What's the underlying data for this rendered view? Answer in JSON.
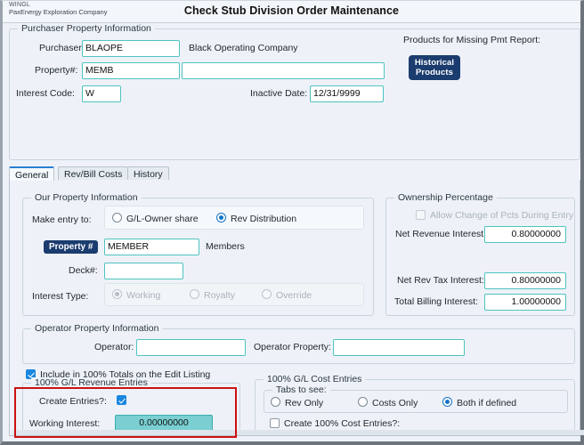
{
  "window": {
    "brand_line1": "WINGL",
    "brand_line2": "PaxEnergy Exploration Company",
    "app_title": "Check Stub Division Order Maintenance",
    "accent_navy": "#1b3c6e",
    "accent_teal": "#4fc3c0",
    "accent_blue": "#1573c6",
    "highlight_red": "#cc1111",
    "background": "#eef2f8"
  },
  "purchaser_group": {
    "legend": "Purchaser Property Information",
    "purchaser_label": "Purchaser:",
    "purchaser_value": "BLAOPE",
    "purchaser_name": "Black Operating Company",
    "property_label": "Property#:",
    "property_value": "MEMB",
    "property_desc_value": "",
    "interest_code_label": "Interest Code:",
    "interest_code_value": "W",
    "inactive_date_label": "Inactive Date:",
    "inactive_date_value": "12/31/9999",
    "products_label": "Products for Missing Pmt Report:",
    "historical_button_line1": "Historical",
    "historical_button_line2": "Products"
  },
  "tabs": [
    {
      "label": "General",
      "active": true
    },
    {
      "label": "Rev/Bill Costs",
      "active": false
    },
    {
      "label": "History",
      "active": false
    }
  ],
  "our_property": {
    "legend": "Our Property Information",
    "make_entry_label": "Make entry to:",
    "make_entry_options": [
      {
        "label": "G/L-Owner share",
        "selected": false
      },
      {
        "label": "Rev Distribution",
        "selected": true
      }
    ],
    "property_badge": "Property #",
    "property_value": "MEMBER",
    "property_desc": "Members",
    "deck_label": "Deck#:",
    "deck_value": "",
    "interest_type_label": "Interest Type:",
    "interest_type_options": [
      {
        "label": "Working",
        "selected": true
      },
      {
        "label": "Royalty",
        "selected": false
      },
      {
        "label": "Override",
        "selected": false
      }
    ]
  },
  "ownership": {
    "legend": "Ownership Percentage",
    "allow_change_label": "Allow Change of Pcts During Entry",
    "allow_change_checked": false,
    "net_revenue_label": "Net Revenue Interest:",
    "net_revenue_value": "0.80000000",
    "net_rev_tax_label": "Net Rev Tax Interest:",
    "net_rev_tax_value": "0.80000000",
    "total_billing_label": "Total Billing Interest:",
    "total_billing_value": "1.00000000"
  },
  "operator": {
    "legend": "Operator Property Information",
    "operator_label": "Operator:",
    "operator_value": "",
    "operator_property_label": "Operator Property:",
    "operator_property_value": ""
  },
  "include_totals": {
    "label": "Include in 100% Totals on the Edit Listing",
    "checked": true
  },
  "revenue_entries": {
    "legend": "100% G/L Revenue Entries",
    "create_entries_label": "Create Entries?:",
    "create_entries_checked": true,
    "working_interest_label": "Working Interest:",
    "working_interest_value": "0.00000000"
  },
  "cost_entries": {
    "legend": "100% G/L Cost Entries",
    "tabs_to_see_legend": "Tabs to see:",
    "tabs_to_see_options": [
      {
        "label": "Rev Only",
        "selected": false
      },
      {
        "label": "Costs Only",
        "selected": false
      },
      {
        "label": "Both if defined",
        "selected": true
      }
    ],
    "create_cost_label": "Create 100% Cost Entries?:",
    "create_cost_checked": false
  }
}
